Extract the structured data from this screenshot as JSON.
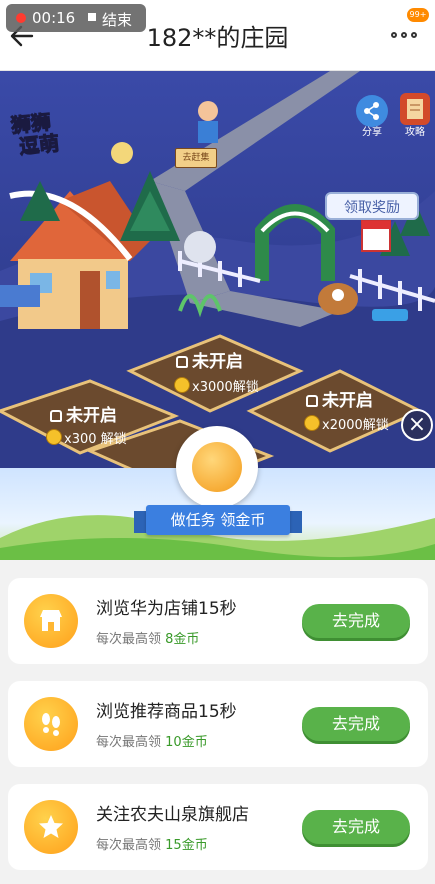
{
  "status": {
    "time": "00:16",
    "end_label": "结束",
    "badge": "99+"
  },
  "header": {
    "title": "182**的庄园"
  },
  "scene": {
    "logo_line1": "狮狮",
    "logo_line2": "逗萌",
    "share_label": "分享",
    "guide_label": "攻略",
    "claim_reward": "领取奖励",
    "signpost": "去赶集",
    "plots": [
      {
        "label": "未开启",
        "cost": "x3000解锁"
      },
      {
        "label": "未开启",
        "cost": "x300 解锁"
      },
      {
        "label": "未开启",
        "cost": "x2000解锁"
      }
    ]
  },
  "banner": {
    "ribbon": "做任务 领金币"
  },
  "tasks": [
    {
      "title": "浏览华为店铺15秒",
      "sub_prefix": "每次最高领",
      "reward": "8金币",
      "button": "去完成",
      "icon": "shop-icon"
    },
    {
      "title": "浏览推荐商品15秒",
      "sub_prefix": "每次最高领",
      "reward": "10金币",
      "button": "去完成",
      "icon": "footprint-icon"
    },
    {
      "title": "关注农夫山泉旗舰店",
      "sub_prefix": "每次最高领",
      "reward": "15金币",
      "button": "去完成",
      "icon": "star-icon"
    }
  ],
  "colors": {
    "accent_green": "#59b24a",
    "reward_green": "#3a9a2a",
    "scene_blue": "#2c3e86",
    "coin_orange": "#ff9f1a"
  }
}
